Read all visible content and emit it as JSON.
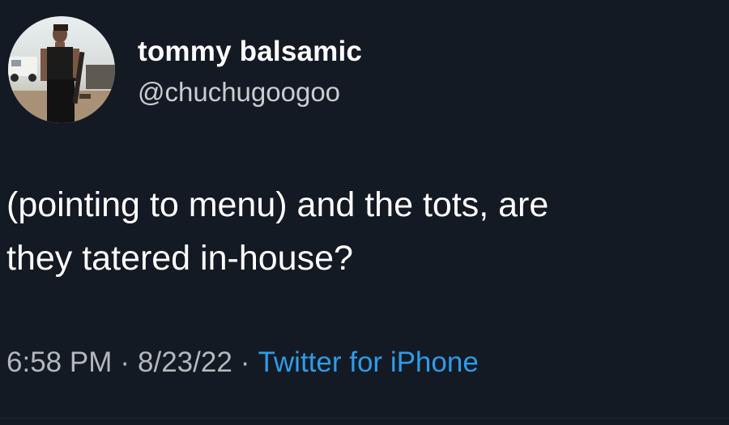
{
  "tweet": {
    "display_name": "tommy balsamic",
    "handle": "@chuchugoogoo",
    "text": "(pointing to menu) and the tots, are\nthey tatered in-house?",
    "time": "6:58 PM",
    "date": "8/23/22",
    "separator": "·",
    "source": "Twitter for iPhone"
  },
  "colors": {
    "background": "#141a23",
    "text_primary": "#ffffff",
    "text_secondary": "#b3b8bd",
    "link": "#2f9be9"
  },
  "avatar": {
    "icon": "profile-photo"
  }
}
